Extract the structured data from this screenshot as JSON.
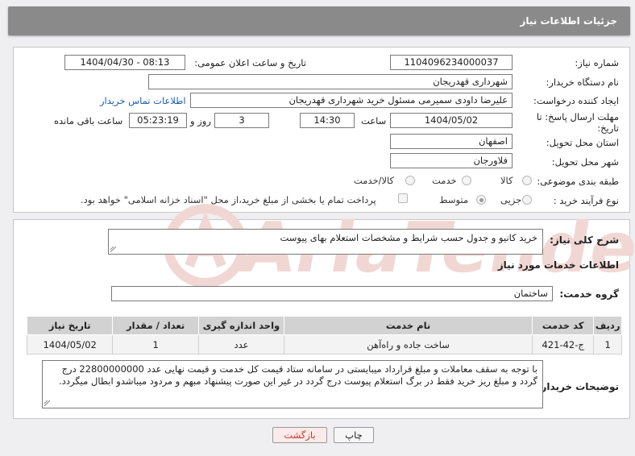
{
  "header": {
    "title": "جزئیات اطلاعات نیاز"
  },
  "form": {
    "need_number": {
      "label": "شماره نیاز:",
      "value": "1104096234000037"
    },
    "announce_datetime": {
      "label": "تاریخ و ساعت اعلان عمومی:",
      "value": "1404/04/30 - 08:13"
    },
    "buyer_org": {
      "label": "نام دستگاه خریدار:",
      "value": "شهرداری قهدریجان"
    },
    "requester": {
      "label": "ایجاد کننده درخواست:",
      "value": "علیرضا داودی سمیرمی مسئول خرید  شهرداری قهدریجان"
    },
    "buyer_contact_link": "اطلاعات تماس خریدار",
    "deadline": {
      "label_line1": "مهلت ارسال پاسخ: تا",
      "label_line2": "تاریخ:",
      "date": "1404/05/02",
      "time_label": "ساعت",
      "time": "14:30",
      "days": "3",
      "days_label": "روز و",
      "remaining": "05:23:19",
      "remaining_label": "ساعت باقی مانده"
    },
    "province": {
      "label": "استان محل تحویل:",
      "value": "اصفهان"
    },
    "city": {
      "label": "شهر محل تحویل:",
      "value": "فلاورجان"
    },
    "category": {
      "label": "طبقه بندی موضوعی:",
      "options": [
        "کالا",
        "خدمت",
        "کالا/خدمت"
      ],
      "selected": "خدمت"
    },
    "purchase_process": {
      "label": "نوع فرآیند خرید :",
      "options": [
        "جزیی",
        "متوسط"
      ],
      "selected": "متوسط",
      "payment_note": "پرداخت تمام یا بخشی از مبلغ خرید،از محل \"اسناد خزانه اسلامی\" خواهد بود."
    }
  },
  "summary": {
    "label": "شرح کلی نیاز:",
    "value": "خرید کانیو و جدول حسب شرایط و مشخصات استعلام بهای پیوست"
  },
  "services": {
    "section_title": "اطلاعات خدمات مورد نیاز",
    "group_label": "گروه خدمت:",
    "group_value": "ساختمان",
    "table": {
      "headers": [
        "ردیف",
        "کد خدمت",
        "نام خدمت",
        "واحد اندازه گیری",
        "تعداد / مقدار",
        "تاریخ نیاز"
      ],
      "rows": [
        [
          "1",
          "ج-42-421",
          "ساخت جاده و راه‌آهن",
          "عدد",
          "1",
          "1404/05/02"
        ]
      ]
    }
  },
  "buyer_notes": {
    "label": "توضیحات خریدار:",
    "value": "با توجه به سقف معاملات و مبلغ قرارداد میبایستی در سامانه ستاد قیمت کل خدمت و قیمت نهایی عدد 22800000000 درج گردد و مبلغ ریز خرید فقط در برگ استعلام پیوست درج گردد در غیر این صورت پیشنهاد مبهم و مردود میباشدو ابطال میگردد."
  },
  "buttons": {
    "print": "چاپ",
    "back": "بازگشت"
  },
  "watermark": {
    "text": "AriaTender.neT"
  },
  "colors": {
    "header": "#8a8a8a",
    "link": "#1a5db5",
    "back_button_text": "#c0392b"
  }
}
